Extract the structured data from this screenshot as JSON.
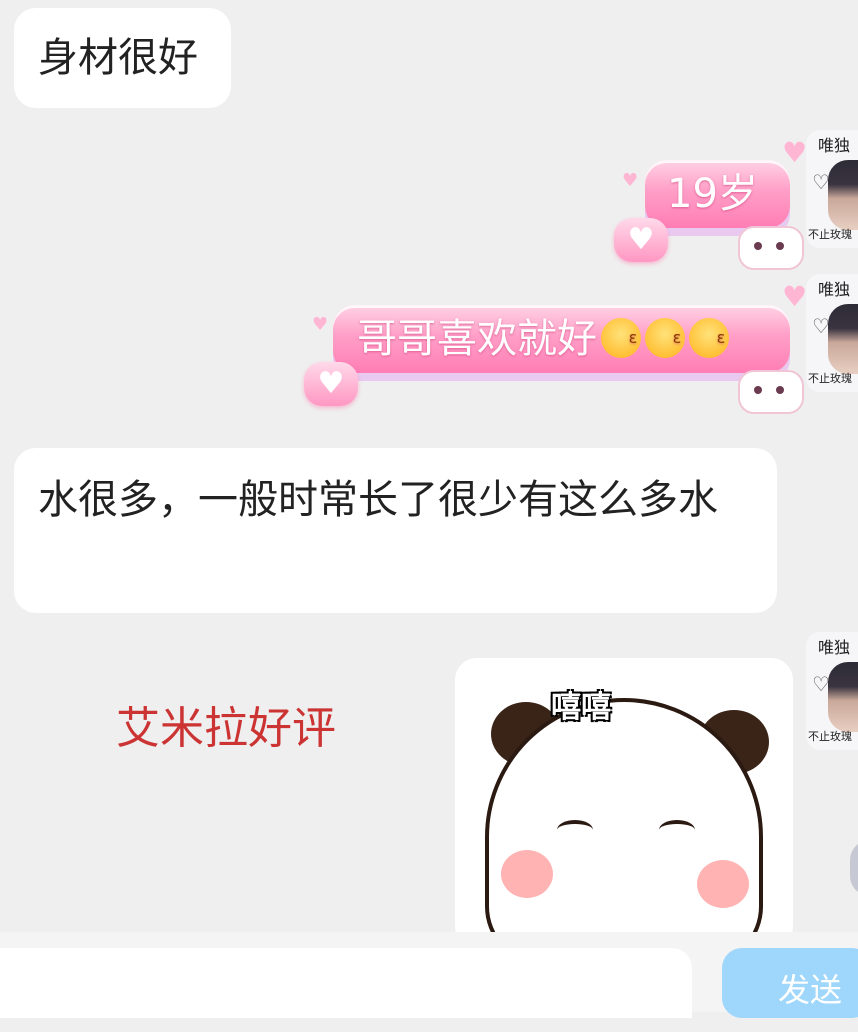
{
  "messages": [
    {
      "side": "incoming",
      "text": "身材很好"
    },
    {
      "side": "outgoing",
      "text": "19岁"
    },
    {
      "side": "outgoing",
      "text": "哥哥喜欢就好",
      "emoji": [
        "kiss-emoji",
        "kiss-emoji",
        "kiss-emoji"
      ]
    },
    {
      "side": "incoming",
      "text": "水很多，一般时常长了很少有这么多水"
    },
    {
      "side": "outgoing",
      "sticker_text": "嘻嘻",
      "sticker": "panda-sticker"
    }
  ],
  "avatar": {
    "top_text": "唯独",
    "bottom_text": "不止玫瑰"
  },
  "review_label": "艾米拉好评",
  "composer": {
    "placeholder": "",
    "send_label": "发送"
  },
  "colors": {
    "background": "#efefef",
    "review_text": "#cc3333",
    "send_button": "#9fd6fb",
    "pink_bubble": "#ff8fbe"
  }
}
